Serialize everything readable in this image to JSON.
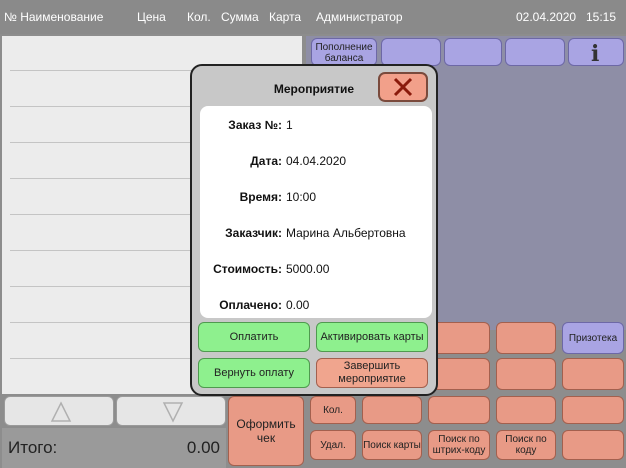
{
  "columns": {
    "name": "№ Наименование",
    "price": "Цена",
    "qty": "Кол.",
    "sum": "Сумма",
    "card": "Карта"
  },
  "header": {
    "user": "Администратор",
    "date": "02.04.2020",
    "time": "15:15"
  },
  "totals": {
    "label": "Итого:",
    "value": "0.00"
  },
  "top_buttons": {
    "topup": "Пополнение баланса"
  },
  "buttons": {
    "checkout": "Оформить чек",
    "qty": "Кол.",
    "delete": "Удал.",
    "search_card": "Поиск карты",
    "search_barcode": "Поиск по штрих-коду",
    "search_code": "Поиск по коду",
    "prizoteka": "Призотека"
  },
  "dialog": {
    "title": "Мероприятие",
    "fields": [
      {
        "label": "Заказ №:",
        "value": "1"
      },
      {
        "label": "Дата:",
        "value": "04.04.2020"
      },
      {
        "label": "Время:",
        "value": "10:00"
      },
      {
        "label": "Заказчик:",
        "value": "Марина Альбертовна"
      },
      {
        "label": "Стоимость:",
        "value": "5000.00"
      },
      {
        "label": "Оплачено:",
        "value": "0.00"
      }
    ],
    "actions": {
      "pay": "Оплатить",
      "activate": "Активировать карты",
      "refund": "Вернуть оплату",
      "finish": "Завершить мероприятие"
    }
  },
  "colors": {
    "accent_violet": "#a9a4e3",
    "salmon": "#e89a86",
    "green": "#8ef08e"
  }
}
